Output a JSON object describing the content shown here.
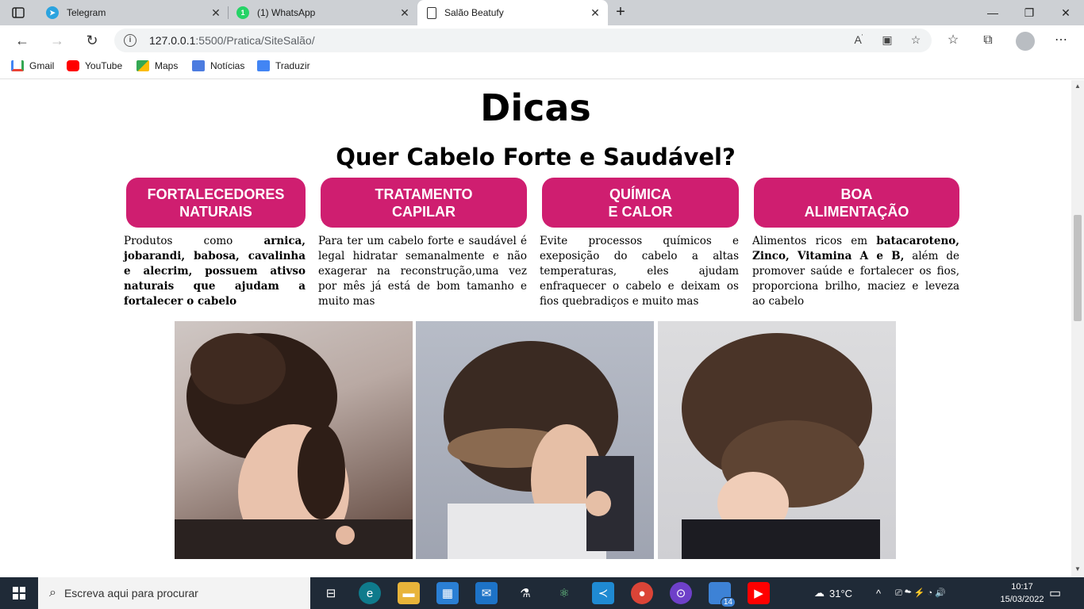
{
  "browser": {
    "tabs": [
      {
        "title": "Telegram",
        "favicon": "telegram-icon",
        "color": "#2aa3df"
      },
      {
        "title": "(1) WhatsApp",
        "favicon": "whatsapp-icon",
        "color": "#25d366",
        "badge": "1"
      },
      {
        "title": "Salão Beatufy",
        "favicon": "page-icon",
        "active": true
      }
    ],
    "url_host": "127.0.0.1",
    "url_rest": ":5500/Pratica/SiteSalão/",
    "bookmarks": [
      {
        "label": "Gmail",
        "icon": "gmail-icon",
        "color": "#ea4335"
      },
      {
        "label": "YouTube",
        "icon": "youtube-icon",
        "color": "#ff0000"
      },
      {
        "label": "Maps",
        "icon": "maps-icon",
        "color": "#34a853"
      },
      {
        "label": "Notícias",
        "icon": "news-icon",
        "color": "#4c7ce0"
      },
      {
        "label": "Traduzir",
        "icon": "translate-icon",
        "color": "#4285f4"
      }
    ]
  },
  "page": {
    "title": "Dicas",
    "subtitle": "Quer Cabelo Forte e Saudável?",
    "accent_color": "#cf1e70",
    "tips": [
      {
        "heading_line1": "FORTALECEDORES",
        "heading_line2": "NATURAIS",
        "text_pre": "Produtos como ",
        "text_bold": "arnica, jobarandi, babosa, cavalinha e alecrim, possuem ativso naturais que ajudam a fortalecer o cabelo",
        "text_post": ""
      },
      {
        "heading_line1": "TRATAMENTO",
        "heading_line2": "CAPILAR",
        "text_pre": "Para ter um cabelo forte e saudável é legal hidratar semanalmente e não exagerar na reconstrução,uma vez por mês já está de bom tamanho e muito mas",
        "text_bold": "",
        "text_post": ""
      },
      {
        "heading_line1": "QUÍMICA",
        "heading_line2": "E CALOR",
        "text_pre": "Evite processos químicos e exeposição do cabelo a altas temperaturas, eles ajudam enfraquecer o cabelo e deixam os fios quebradiços e muito mas",
        "text_bold": "",
        "text_post": ""
      },
      {
        "heading_line1": "BOA",
        "heading_line2": "ALIMENTAÇÃO",
        "text_pre": "Alimentos ricos em ",
        "text_bold": "batacaroteno, Zinco, Vitamina A e B,",
        "text_post": " além de promover saúde e fortalecer os fios, proporciona brilho, maciez e leveza ao cabelo"
      }
    ],
    "photos": [
      "hairstyle-photo-1",
      "hairstyle-photo-2",
      "hairstyle-photo-3"
    ]
  },
  "taskbar": {
    "search_placeholder": "Escreva aqui para procurar",
    "weather": "31°C",
    "badge_count": "14",
    "time": "10:17",
    "date": "15/03/2022"
  }
}
